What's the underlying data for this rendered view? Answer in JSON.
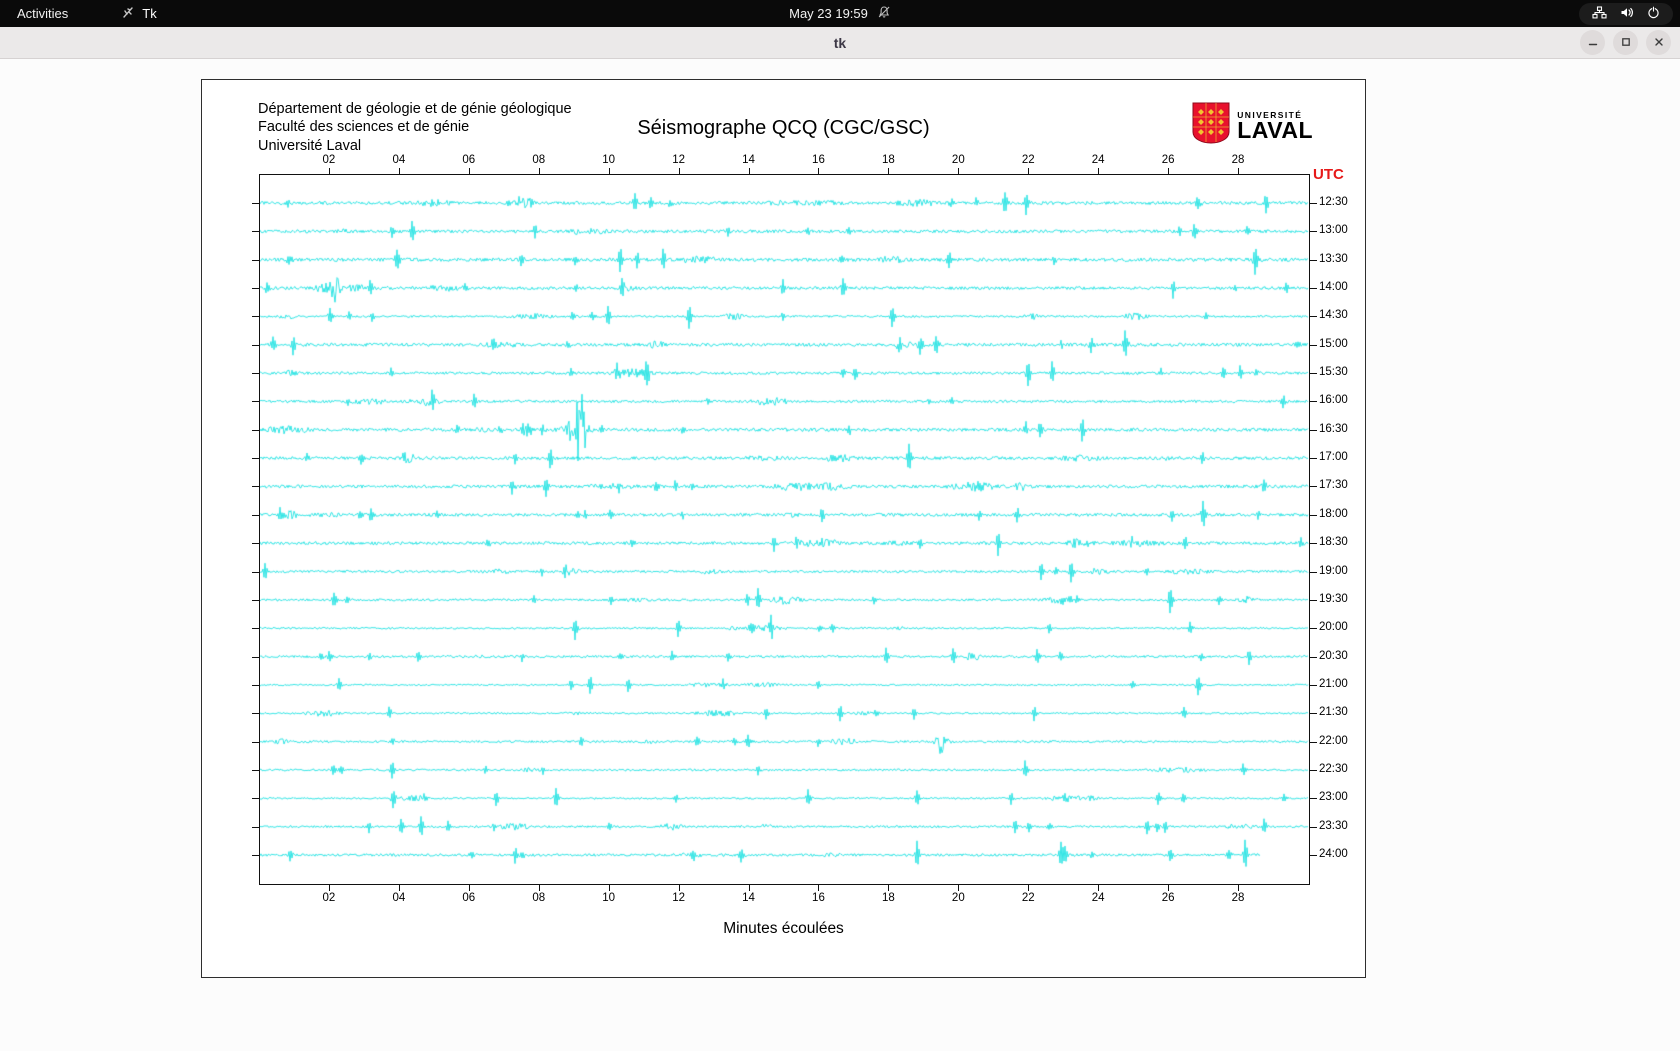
{
  "top_bar": {
    "activities": "Activities",
    "tk_indicator": "Tk",
    "clock": "May 23 19:59",
    "status_icons": [
      "network-icon",
      "volume-icon",
      "power-icon"
    ],
    "notification_icon": "bell-disabled-icon"
  },
  "titlebar": {
    "title": "tk",
    "controls": [
      "minimize-icon",
      "maximize-icon",
      "close-icon"
    ]
  },
  "figure": {
    "institution_lines": [
      "Département de géologie et de génie géologique",
      "Faculté des sciences et de génie",
      "Université Laval"
    ],
    "title": "Séismographe QCQ (CGC/GSC)",
    "logo": {
      "top": "UNIVERSITÉ",
      "bottom": "LAVAL"
    },
    "utc_label": "UTC",
    "x_axis_title": "Minutes écoulées"
  },
  "chart_data": {
    "type": "line",
    "title": "Séismographe QCQ (CGC/GSC)",
    "xlabel": "Minutes écoulées",
    "x_tick_labels": [
      "02",
      "04",
      "06",
      "08",
      "10",
      "12",
      "14",
      "16",
      "18",
      "20",
      "22",
      "24",
      "26",
      "28"
    ],
    "x_range_minutes": [
      0,
      30
    ],
    "trace_interval_minutes": 30,
    "row_labels_utc": [
      "12:30",
      "13:00",
      "13:30",
      "14:00",
      "14:30",
      "15:00",
      "15:30",
      "16:00",
      "16:30",
      "17:00",
      "17:30",
      "18:00",
      "18:30",
      "19:00",
      "19:30",
      "20:00",
      "20:30",
      "21:00",
      "21:30",
      "22:00",
      "22:30",
      "23:00",
      "23:30",
      "24:00"
    ],
    "trace_color": "#00dede",
    "accent_red": "#e61919",
    "last_trace_end_fraction": 0.955,
    "note": "24 half-hour helicorder traces of background noise with sporadic spikes; final trace still recording"
  }
}
